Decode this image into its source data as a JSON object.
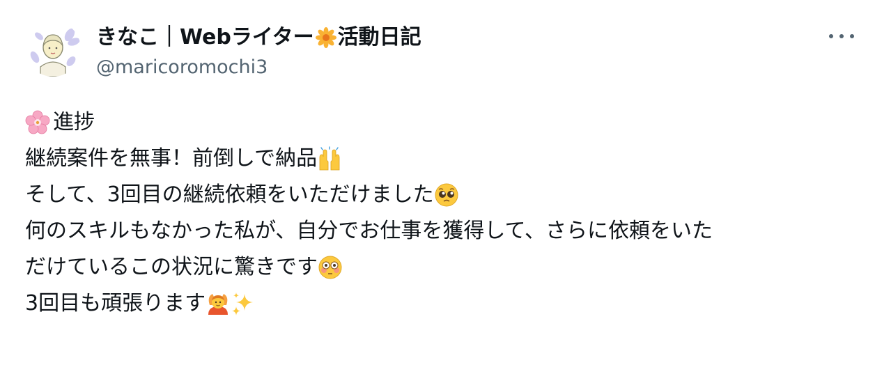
{
  "author": {
    "name_main": "きなこ｜Webライター",
    "name_suffix": "活動日記",
    "name_emoji": "blossom-flower-icon",
    "handle": "@maricoromochi3"
  },
  "tweet": {
    "line1": "進捗",
    "line2": "継続案件を無事！前倒しで納品",
    "line3": "そして、3回目の継続依頼をいただけました",
    "line4": "何のスキルもなかった私が、自分でお仕事を獲得して、さらに依頼をいた",
    "line5": "だけているこの状況に驚きです",
    "line6": "3回目も頑張ります"
  },
  "emojis": {
    "line1_lead": "cherry-blossom-icon",
    "line2_trail": "raising-hands-icon",
    "line3_trail": "pleading-face-icon",
    "line5_trail": "flushed-face-icon",
    "line6_trail1": "person-gesturing-ok-icon",
    "line6_trail2": "sparkles-icon"
  },
  "colors": {
    "text": "#0f1419",
    "secondary": "#536471",
    "background": "#ffffff"
  }
}
